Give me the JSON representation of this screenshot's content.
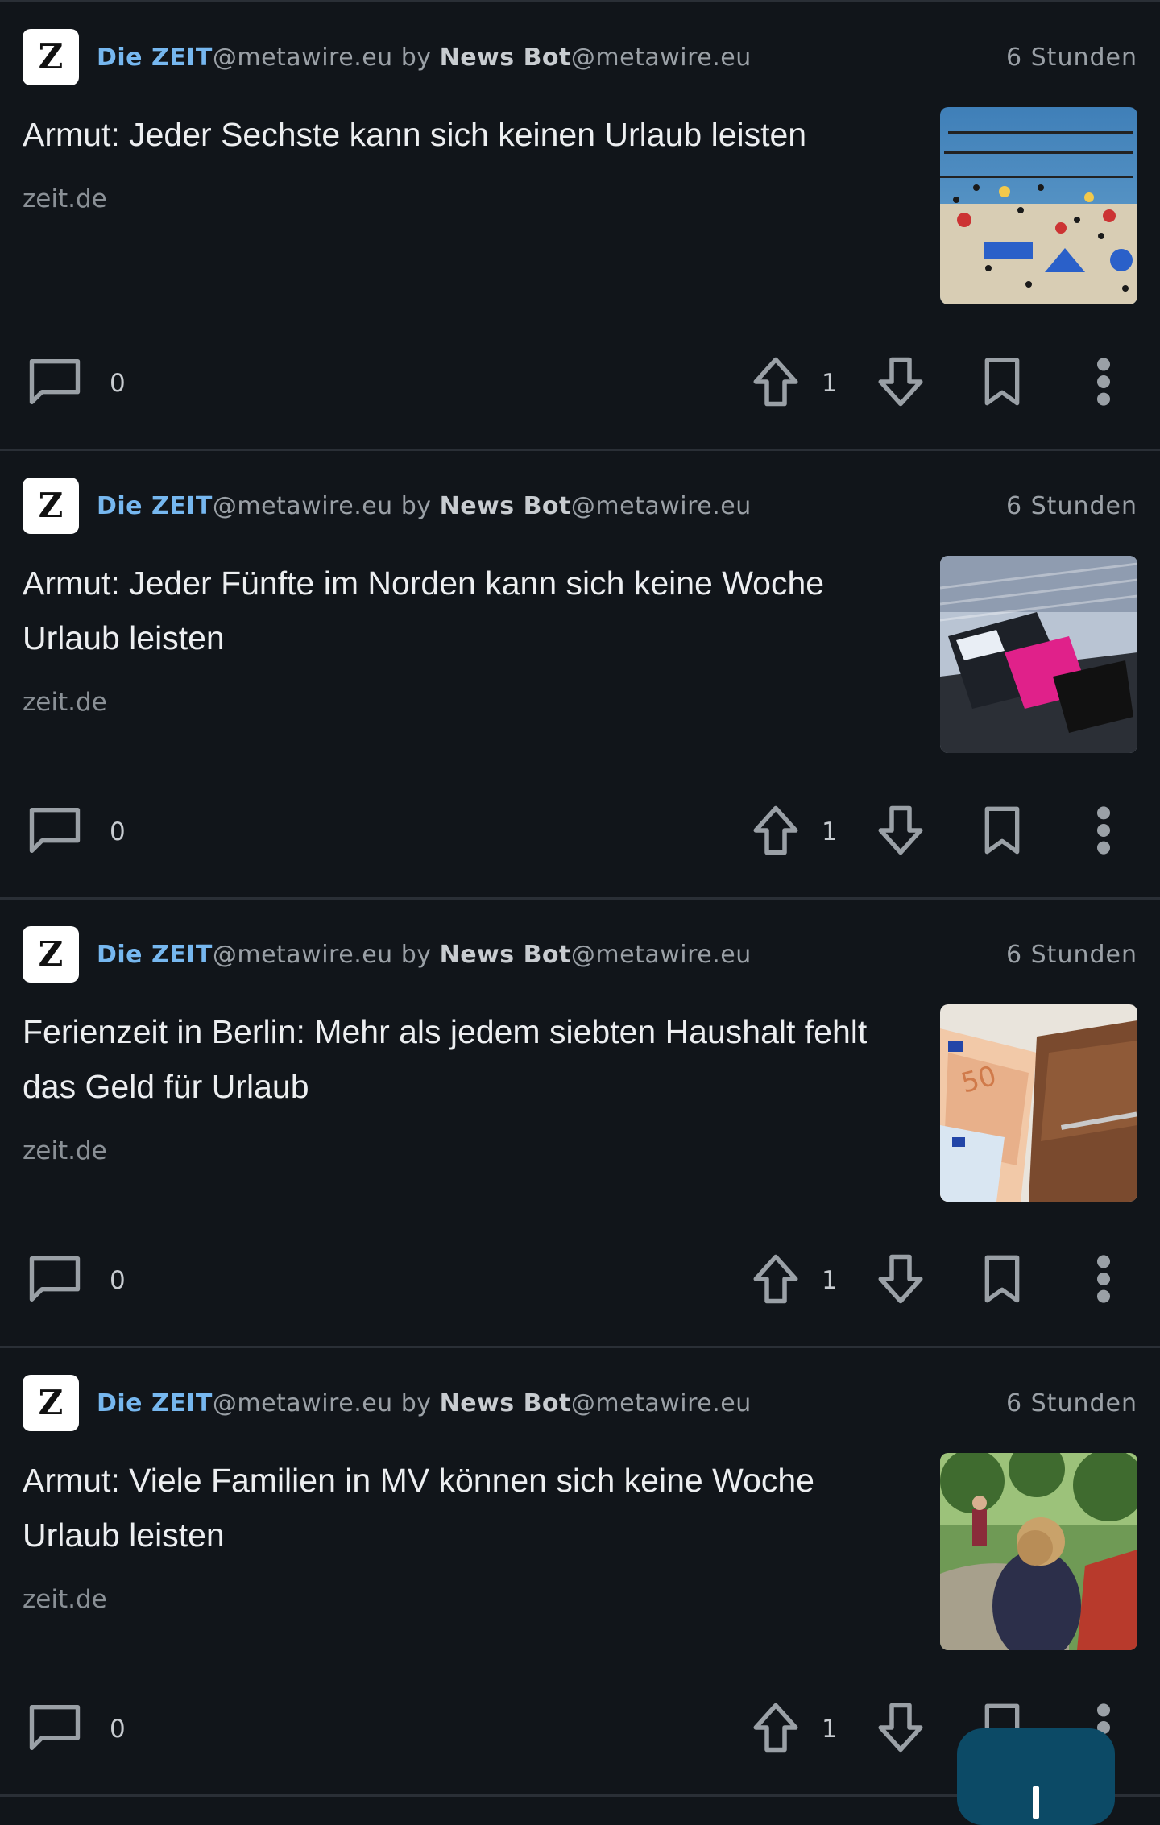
{
  "posts": [
    {
      "avatar_letter": "Z",
      "community": "Die ZEIT",
      "community_instance": "@metawire.eu",
      "by": "by",
      "author": "News Bot",
      "author_instance": "@metawire.eu",
      "time": "6 Stunden",
      "title": "Armut: Jeder Sechste kann sich keinen Urlaub leisten",
      "domain": "zeit.de",
      "thumbnail": "beach-crowd",
      "comments": "0",
      "upvotes": "1"
    },
    {
      "avatar_letter": "Z",
      "community": "Die ZEIT",
      "community_instance": "@metawire.eu",
      "by": "by",
      "author": "News Bot",
      "author_instance": "@metawire.eu",
      "time": "6 Stunden",
      "title": "Armut: Jeder Fünfte im Norden kann sich keine Woche Urlaub leisten",
      "domain": "zeit.de",
      "thumbnail": "luggage-belt",
      "comments": "0",
      "upvotes": "1"
    },
    {
      "avatar_letter": "Z",
      "community": "Die ZEIT",
      "community_instance": "@metawire.eu",
      "by": "by",
      "author": "News Bot",
      "author_instance": "@metawire.eu",
      "time": "6 Stunden",
      "title": "Ferienzeit in Berlin: Mehr als jedem siebten Haushalt fehlt das Geld für Urlaub",
      "domain": "zeit.de",
      "thumbnail": "euro-wallet",
      "comments": "0",
      "upvotes": "1"
    },
    {
      "avatar_letter": "Z",
      "community": "Die ZEIT",
      "community_instance": "@metawire.eu",
      "by": "by",
      "author": "News Bot",
      "author_instance": "@metawire.eu",
      "time": "6 Stunden",
      "title": "Armut: Viele Familien in MV können sich keine Woche Urlaub leisten",
      "domain": "zeit.de",
      "thumbnail": "child-playground",
      "comments": "0",
      "upvotes": "1"
    }
  ],
  "icons": {
    "comment": "comment-icon",
    "upvote": "upvote-arrow-icon",
    "downvote": "downvote-arrow-icon",
    "save": "bookmark-icon",
    "more": "more-vertical-icon",
    "fab": "plus-icon"
  },
  "colors": {
    "background": "#11151a",
    "community": "#76b7ef",
    "fab": "#0c4a66"
  }
}
